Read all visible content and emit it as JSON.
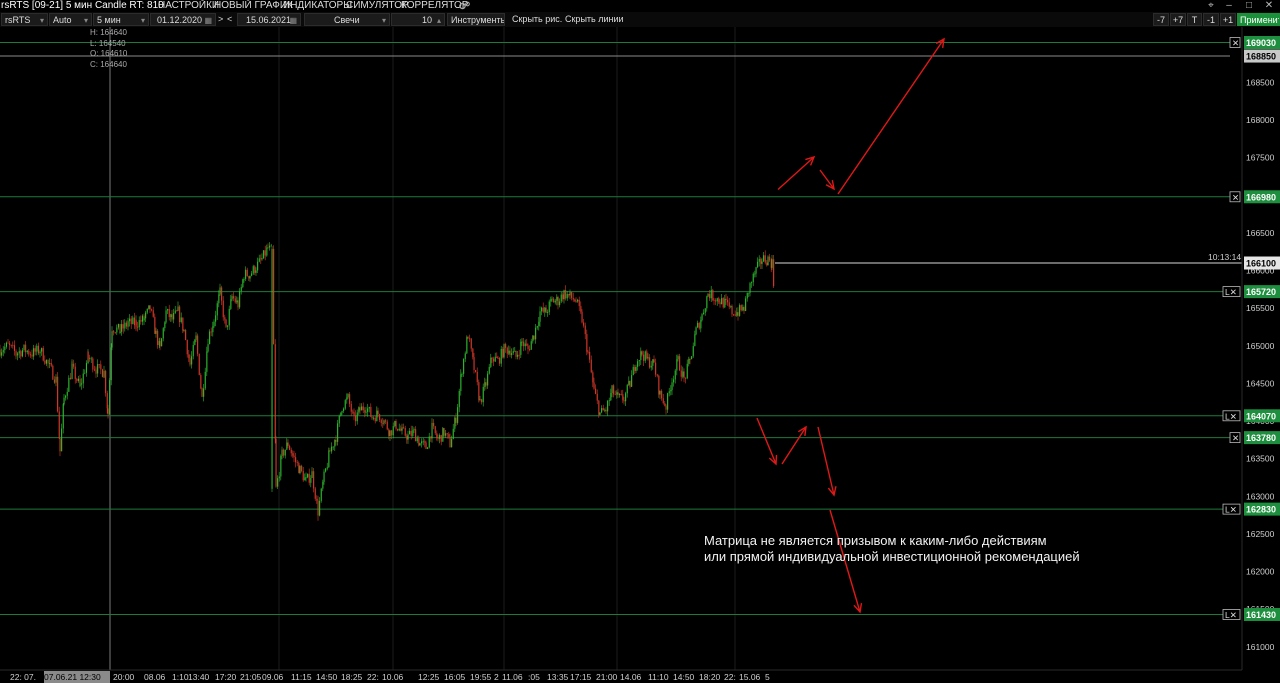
{
  "window": {
    "title": "rsRTS [09-21] 5 мин Candle RT: 810",
    "menu": [
      {
        "label": "НАСТРОЙКИ",
        "color": "#ff3b7a"
      },
      {
        "label": "НОВЫЙ ГРАФИК",
        "color": "#ff8a2a"
      },
      {
        "label": "ИНДИКАТОРЫ",
        "color": "#3ed04b"
      },
      {
        "label": "СИМУЛЯТОР",
        "color": "#d060ff"
      },
      {
        "label": "КОРРЕЛЯТОР",
        "color": "#4aa0ff"
      }
    ],
    "settings_icon": "gears-icon",
    "controls": {
      "pin": "pin-icon",
      "minimize": "minimize-icon",
      "maximize": "maximize-icon",
      "close": "close-icon"
    }
  },
  "toolbar": {
    "symbol": "rsRTS",
    "scale_mode": "Auto",
    "timeframe": "5 мин",
    "date_from": "01.12.2020",
    "nav_next": ">",
    "nav_prev": "<",
    "date_to": "15.06.2021",
    "chart_type": "Свечи",
    "count": "10",
    "tools": "Инструменты",
    "hide_drawings": "Скрыть рис.",
    "hide_lines": "Скрыть линии",
    "btn_minus7": "-7",
    "btn_plus7": "+7",
    "btn_t": "T",
    "btn_minus1": "-1",
    "btn_plus1": "+1",
    "apply": "Применить"
  },
  "ohlc": {
    "h": "H: 164640",
    "l": "L: 164540",
    "o": "O: 164610",
    "c": "C: 164640"
  },
  "chart_data": {
    "type": "candlestick",
    "instrument": "rsRTS [09-21]",
    "timeframe": "5 мин",
    "ylim": [
      160650,
      169400
    ],
    "y_ticks": [
      161000,
      161500,
      162000,
      162500,
      163000,
      163500,
      164000,
      164500,
      165000,
      165500,
      166000,
      166500,
      167000,
      167500,
      168000,
      168500
    ],
    "x_labels": [
      "22: 07.",
      "07.06.21 12:30",
      "20:00",
      "08.06",
      "1:10",
      "13:40",
      "17:20",
      "21:05",
      "09.06",
      "11:15",
      "14:50",
      "18:25",
      "22:",
      "10.06",
      "12:25",
      "16:05",
      "19:55",
      "2",
      "11.06",
      ":05",
      "13:35",
      "17:15",
      "21:00",
      "14.06",
      "11:10",
      "14:50",
      "18:20",
      "22:",
      "15.06",
      "5"
    ],
    "crosshair_label": "07.06.21 12:30",
    "current_price": 166100,
    "current_time": "10:13:14",
    "levels": [
      {
        "price": 169030,
        "tag": "✕",
        "box": "green"
      },
      {
        "price": 168850,
        "tag": "",
        "box": "gray"
      },
      {
        "price": 166980,
        "tag": "✕",
        "box": "green"
      },
      {
        "price": 165720,
        "tag": "L✕",
        "box": "green"
      },
      {
        "price": 164070,
        "tag": "L✕",
        "box": "green"
      },
      {
        "price": 163780,
        "tag": "✕",
        "box": "green"
      },
      {
        "price": 162830,
        "tag": "L✕",
        "box": "green"
      },
      {
        "price": 161430,
        "tag": "L✕",
        "box": "green"
      }
    ],
    "price_path": [
      [
        0,
        164950
      ],
      [
        8,
        165000
      ],
      [
        16,
        164900
      ],
      [
        24,
        164950
      ],
      [
        32,
        164900
      ],
      [
        40,
        164950
      ],
      [
        48,
        164750
      ],
      [
        56,
        164550
      ],
      [
        60,
        163600
      ],
      [
        64,
        164300
      ],
      [
        72,
        164700
      ],
      [
        80,
        164450
      ],
      [
        88,
        164850
      ],
      [
        96,
        164700
      ],
      [
        104,
        164650
      ],
      [
        108,
        164100
      ],
      [
        112,
        165250
      ],
      [
        120,
        165200
      ],
      [
        128,
        165300
      ],
      [
        136,
        165300
      ],
      [
        144,
        165350
      ],
      [
        150,
        165500
      ],
      [
        156,
        165150
      ],
      [
        160,
        164950
      ],
      [
        166,
        165450
      ],
      [
        172,
        165350
      ],
      [
        178,
        165450
      ],
      [
        184,
        165200
      ],
      [
        190,
        164750
      ],
      [
        196,
        165100
      ],
      [
        202,
        164300
      ],
      [
        208,
        165100
      ],
      [
        214,
        165350
      ],
      [
        220,
        165700
      ],
      [
        226,
        165200
      ],
      [
        232,
        165650
      ],
      [
        238,
        165550
      ],
      [
        244,
        165950
      ],
      [
        250,
        165950
      ],
      [
        256,
        166050
      ],
      [
        262,
        166150
      ],
      [
        268,
        166300
      ],
      [
        272,
        166250
      ],
      [
        276,
        163100
      ],
      [
        282,
        163550
      ],
      [
        288,
        163700
      ],
      [
        294,
        163500
      ],
      [
        300,
        163350
      ],
      [
        306,
        163200
      ],
      [
        312,
        163300
      ],
      [
        318,
        162800
      ],
      [
        324,
        163250
      ],
      [
        330,
        163600
      ],
      [
        336,
        163800
      ],
      [
        342,
        164200
      ],
      [
        348,
        164300
      ],
      [
        354,
        164000
      ],
      [
        360,
        164150
      ],
      [
        366,
        164200
      ],
      [
        372,
        164050
      ],
      [
        378,
        164100
      ],
      [
        384,
        164000
      ],
      [
        390,
        163850
      ],
      [
        396,
        163950
      ],
      [
        402,
        163850
      ],
      [
        408,
        163800
      ],
      [
        414,
        163850
      ],
      [
        420,
        163700
      ],
      [
        426,
        163650
      ],
      [
        432,
        163900
      ],
      [
        438,
        163750
      ],
      [
        444,
        163850
      ],
      [
        450,
        163700
      ],
      [
        456,
        164050
      ],
      [
        462,
        164700
      ],
      [
        468,
        165150
      ],
      [
        474,
        164700
      ],
      [
        480,
        164250
      ],
      [
        486,
        164500
      ],
      [
        492,
        164850
      ],
      [
        498,
        164800
      ],
      [
        504,
        164950
      ],
      [
        510,
        164950
      ],
      [
        516,
        164850
      ],
      [
        522,
        165050
      ],
      [
        528,
        164950
      ],
      [
        534,
        165150
      ],
      [
        540,
        165450
      ],
      [
        546,
        165450
      ],
      [
        552,
        165600
      ],
      [
        558,
        165600
      ],
      [
        564,
        165700
      ],
      [
        570,
        165650
      ],
      [
        576,
        165600
      ],
      [
        582,
        165350
      ],
      [
        588,
        164900
      ],
      [
        594,
        164400
      ],
      [
        600,
        164100
      ],
      [
        606,
        164150
      ],
      [
        612,
        164400
      ],
      [
        618,
        164300
      ],
      [
        624,
        164300
      ],
      [
        630,
        164500
      ],
      [
        636,
        164800
      ],
      [
        642,
        164900
      ],
      [
        648,
        164800
      ],
      [
        654,
        164750
      ],
      [
        660,
        164350
      ],
      [
        666,
        164200
      ],
      [
        672,
        164550
      ],
      [
        678,
        164800
      ],
      [
        684,
        164550
      ],
      [
        690,
        164800
      ],
      [
        696,
        165200
      ],
      [
        702,
        165400
      ],
      [
        708,
        165700
      ],
      [
        714,
        165650
      ],
      [
        720,
        165600
      ],
      [
        726,
        165550
      ],
      [
        732,
        165450
      ],
      [
        738,
        165450
      ],
      [
        744,
        165500
      ],
      [
        750,
        165800
      ],
      [
        756,
        166000
      ],
      [
        762,
        166150
      ],
      [
        768,
        166150
      ],
      [
        772,
        166100
      ],
      [
        774,
        165750
      ]
    ],
    "arrows": [
      [
        [
          778,
          162.5
        ],
        [
          814,
          130
        ]
      ],
      [
        [
          820,
          143
        ],
        [
          834,
          162
        ]
      ],
      [
        [
          838,
          167
        ],
        [
          944,
          12
        ]
      ],
      [
        [
          757,
          391
        ],
        [
          776,
          437
        ]
      ],
      [
        [
          782,
          437
        ],
        [
          806,
          400
        ]
      ],
      [
        [
          818,
          400
        ],
        [
          834,
          468
        ]
      ],
      [
        [
          830,
          483
        ],
        [
          860,
          585
        ]
      ]
    ]
  },
  "disclaimer": {
    "line1": "Матрица не является призывом к каким-либо действиям",
    "line2": "или прямой индивидуальной инвестиционной рекомендацией"
  }
}
